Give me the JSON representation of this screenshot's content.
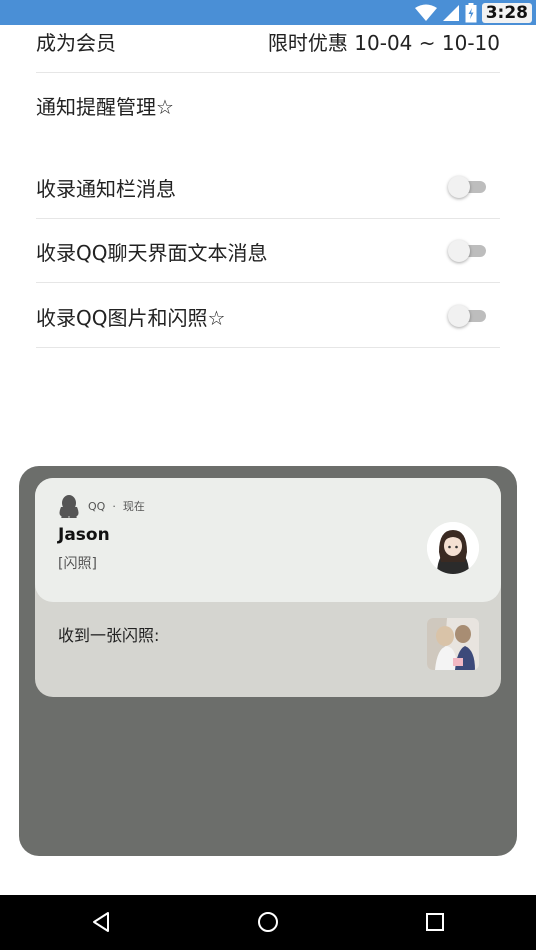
{
  "status_bar": {
    "time": "3:28",
    "icons": [
      "wifi-icon",
      "signal-icon",
      "battery-icon"
    ]
  },
  "settings": {
    "membership": {
      "label": "成为会员",
      "value": "限时优惠 10-04 ~ 10-10"
    },
    "notification_manage": {
      "label": "通知提醒管理☆"
    },
    "toggles": [
      {
        "label": "收录通知栏消息",
        "on": false
      },
      {
        "label": "收录QQ聊天界面文本消息",
        "on": false
      },
      {
        "label": "收录QQ图片和闪照☆",
        "on": false
      }
    ]
  },
  "preview": {
    "app_name": "QQ",
    "separator": "·",
    "time": "现在",
    "sender": "Jason",
    "message": "[闪照]",
    "stack_message": "收到一张闪照:"
  },
  "nav_bar": {
    "icons": [
      "back-icon",
      "home-icon",
      "recents-icon"
    ]
  },
  "colors": {
    "status_bar": "#4a8fd6",
    "panel": "#6c6e6b",
    "card": "#eceeeb",
    "nav_bar": "#000000"
  }
}
